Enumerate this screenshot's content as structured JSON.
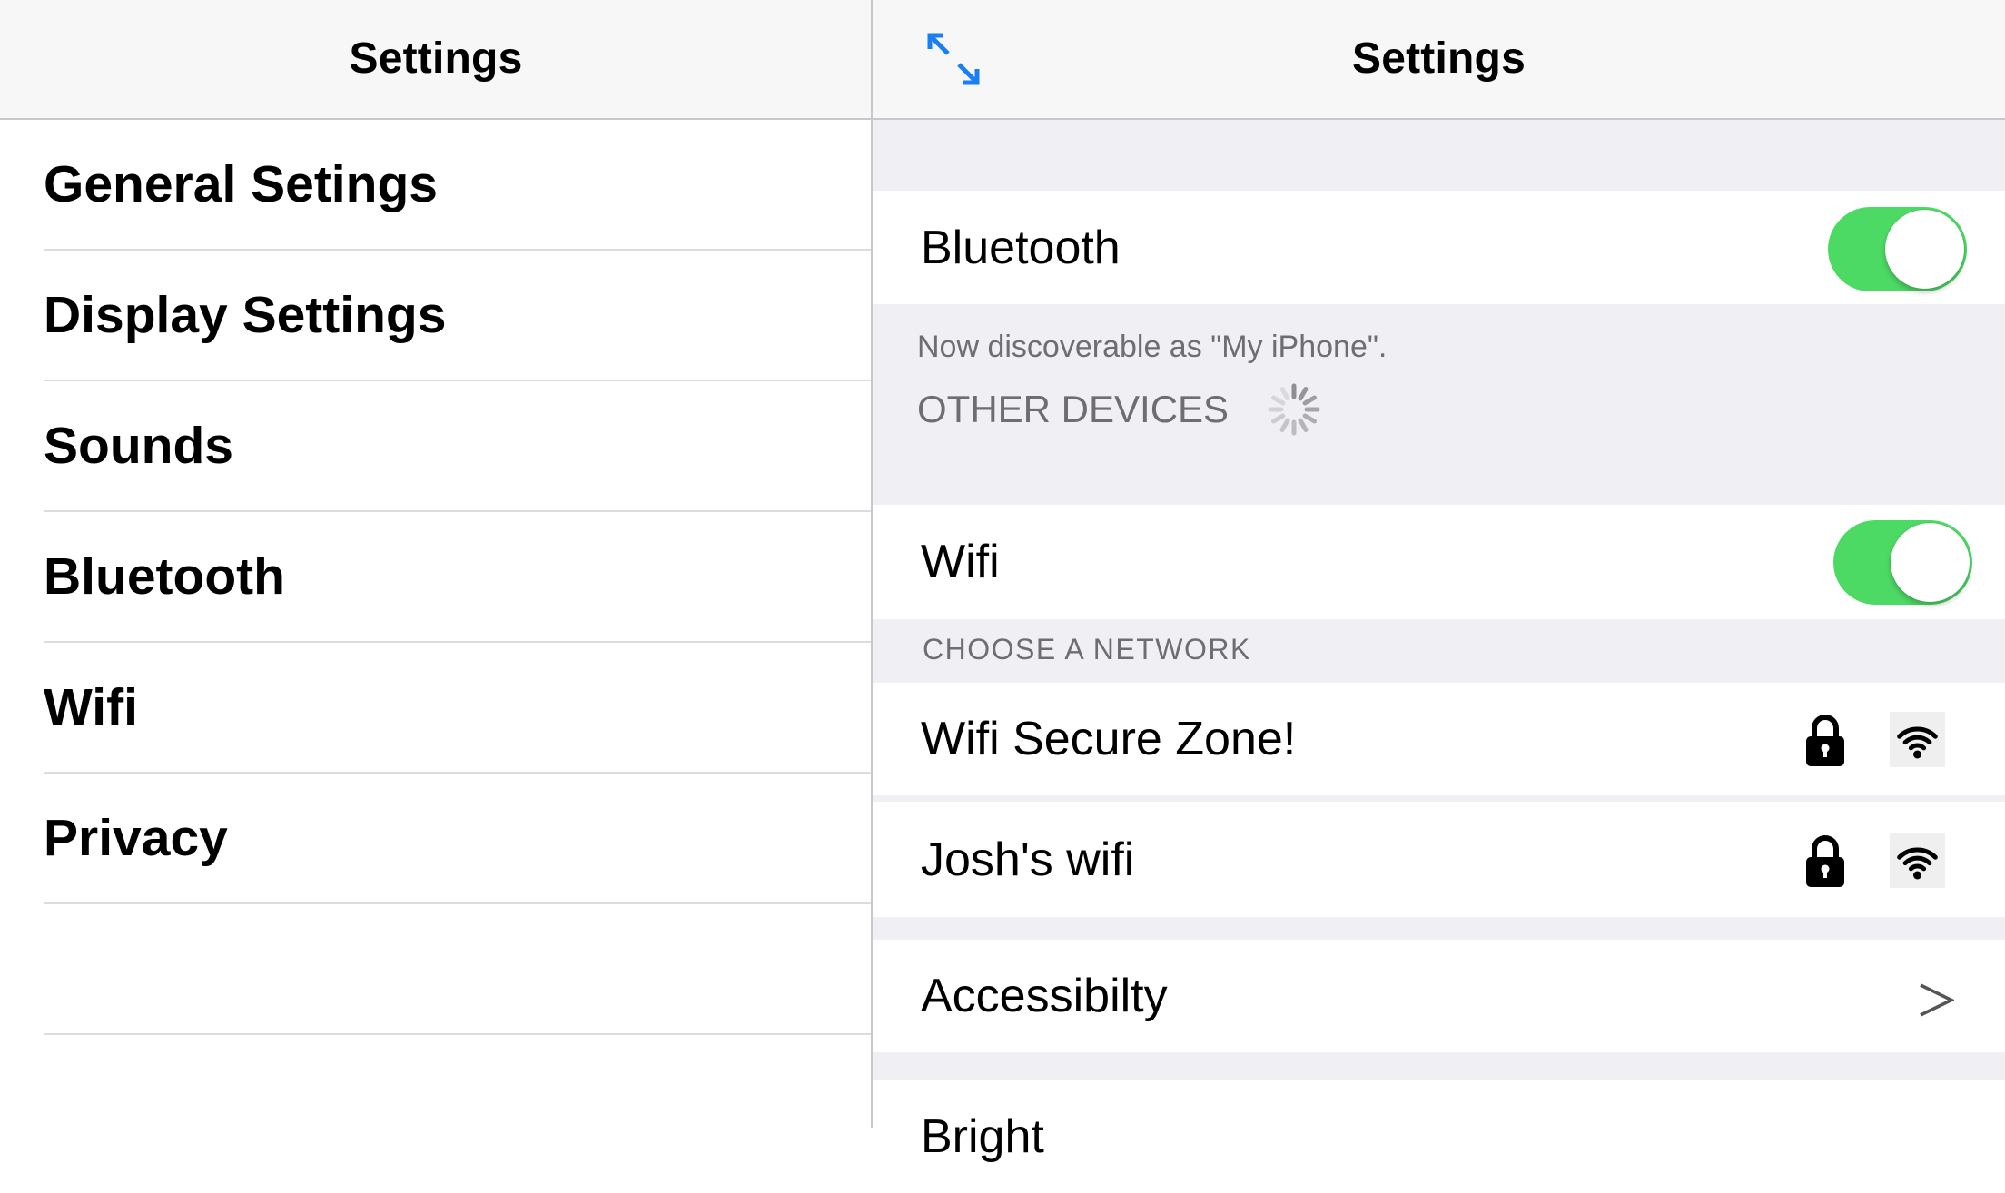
{
  "master": {
    "title": "Settings",
    "items": [
      {
        "label": "General Setings"
      },
      {
        "label": "Display Settings"
      },
      {
        "label": "Sounds"
      },
      {
        "label": "Bluetooth"
      },
      {
        "label": "Wifi"
      },
      {
        "label": "Privacy"
      }
    ]
  },
  "detail": {
    "title": "Settings",
    "expand_icon": "expand-icon",
    "bluetooth": {
      "label": "Bluetooth",
      "enabled": true,
      "discoverable_text": "Now discoverable as \"My iPhone\".",
      "other_devices_label": "OTHER DEVICES",
      "scanning_icon": "activity-spinner-icon"
    },
    "wifi": {
      "label": "Wifi",
      "enabled": true,
      "section_header": "CHOOSE A NETWORK",
      "networks": [
        {
          "name": "Wifi Secure Zone!",
          "secured": true,
          "icons": [
            "lock-icon",
            "wifi-signal-icon"
          ]
        },
        {
          "name": "Josh's wifi",
          "secured": true,
          "icons": [
            "lock-icon",
            "wifi-signal-icon"
          ]
        }
      ]
    },
    "accessibility": {
      "label": "Accessibilty",
      "icon": "chevron-right-icon"
    },
    "next_row": {
      "label": "Bright"
    }
  },
  "colors": {
    "toggle_on": "#4cd964",
    "accent": "#1a7ff5",
    "group_background": "#efeff4",
    "footer_text": "#6d6d72"
  }
}
